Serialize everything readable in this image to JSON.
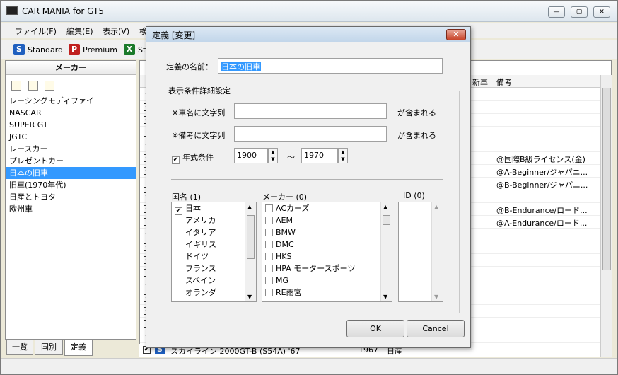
{
  "window": {
    "title": "CAR MANIA for GT5",
    "min": "—",
    "max": "▢",
    "close": "✕"
  },
  "menu": [
    {
      "label": "ファイル(F)"
    },
    {
      "label": "編集(E)"
    },
    {
      "label": "表示(V)"
    },
    {
      "label": "検"
    }
  ],
  "toolbar": [
    {
      "icon": "S",
      "label": "Standard",
      "color": "#1f5fbf"
    },
    {
      "icon": "P",
      "label": "Premium",
      "color": "#c0201f"
    },
    {
      "icon": "X",
      "label": "St",
      "color": "#1a7a2a"
    }
  ],
  "left": {
    "header": "メーカー",
    "items": [
      "レーシングモディファイ",
      "NASCAR",
      "SUPER GT",
      "JGTC",
      "レースカー",
      "プレゼントカー",
      "日本の旧車",
      "旧車(1970年代)",
      "日産とトヨタ",
      "欧州車"
    ],
    "selected_index": 6,
    "tabs": [
      "一覧",
      "国別",
      "定義"
    ]
  },
  "grid": {
    "headers": [
      "新車",
      "備考"
    ],
    "rows": [
      {
        "note": "",
        "checked": true
      },
      {
        "note": "",
        "checked": true
      },
      {
        "note": "",
        "checked": true
      },
      {
        "note": "",
        "checked": true
      },
      {
        "note": "",
        "checked": true
      },
      {
        "note": "@国際B級ライセンス(金)",
        "checked": true
      },
      {
        "note": "@A-Beginner/ジャパニ...",
        "checked": true
      },
      {
        "note": "@B-Beginner/ジャパニ...",
        "checked": true
      },
      {
        "note": "",
        "checked": true
      },
      {
        "note": "@B-Endurance/ロード...",
        "checked": true
      },
      {
        "note": "@A-Endurance/ロード...",
        "checked": true
      },
      {
        "note": "",
        "checked": true
      },
      {
        "note": "",
        "checked": true
      },
      {
        "note": "",
        "checked": true
      },
      {
        "note": "",
        "checked": true
      },
      {
        "note": "",
        "checked": true
      },
      {
        "note": "",
        "checked": true
      },
      {
        "note": "",
        "checked": true
      },
      {
        "note": "",
        "checked": true
      },
      {
        "note": "",
        "checked": true
      }
    ],
    "bottom_row": {
      "name": "スカイライン 2000GT-B (S54A) '67",
      "year": "1967",
      "maker": "日産"
    }
  },
  "dialog": {
    "title": "定義 [変更]",
    "name_label": "定義の名前：",
    "name_value": "日本の旧車",
    "group_label": "表示条件詳細設定",
    "car_label": "※車名に文字列",
    "car_suffix": "が含まれる",
    "note_label": "※備考に文字列",
    "note_suffix": "が含まれる",
    "year_label": "年式条件",
    "year_from": "1900",
    "year_to": "1970",
    "tilde": "～",
    "country_header": "国名 (1)",
    "countries": [
      {
        "name": "日本",
        "checked": true
      },
      {
        "name": "アメリカ",
        "checked": false
      },
      {
        "name": "イタリア",
        "checked": false
      },
      {
        "name": "イギリス",
        "checked": false
      },
      {
        "name": "ドイツ",
        "checked": false
      },
      {
        "name": "フランス",
        "checked": false
      },
      {
        "name": "スペイン",
        "checked": false
      },
      {
        "name": "オランダ",
        "checked": false
      }
    ],
    "maker_header": "メーカー (0)",
    "makers": [
      "ACカーズ",
      "AEM",
      "BMW",
      "DMC",
      "HKS",
      "HPA モータースポーツ",
      "MG",
      "RE雨宮"
    ],
    "id_header": "ID (0)",
    "ok": "OK",
    "cancel": "Cancel"
  }
}
